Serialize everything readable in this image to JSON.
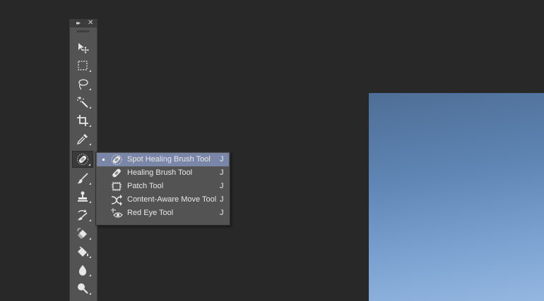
{
  "panel": {
    "collapse_glyph": "▸▸",
    "close_glyph": "✕",
    "tools": [
      {
        "name": "move-tool",
        "icon": "move-icon"
      },
      {
        "name": "rectangular-marquee-tool",
        "icon": "marquee-icon"
      },
      {
        "name": "lasso-tool",
        "icon": "lasso-icon"
      },
      {
        "name": "magic-wand-tool",
        "icon": "magic-wand-icon"
      },
      {
        "name": "crop-tool",
        "icon": "crop-icon"
      },
      {
        "name": "eyedropper-tool",
        "icon": "eyedropper-icon"
      },
      {
        "name": "spot-healing-brush-tool",
        "icon": "spot-healing-icon",
        "active": true
      },
      {
        "name": "brush-tool",
        "icon": "brush-icon"
      },
      {
        "name": "clone-stamp-tool",
        "icon": "stamp-icon"
      },
      {
        "name": "history-brush-tool",
        "icon": "history-brush-icon"
      },
      {
        "name": "eraser-tool",
        "icon": "eraser-icon"
      },
      {
        "name": "paint-bucket-tool",
        "icon": "paint-bucket-icon"
      },
      {
        "name": "blur-tool",
        "icon": "blur-drop-icon"
      },
      {
        "name": "dodge-tool",
        "icon": "dodge-icon"
      }
    ]
  },
  "flyout": {
    "items": [
      {
        "label": "Spot Healing Brush Tool",
        "shortcut": "J",
        "icon": "spot-healing-icon",
        "selected": true
      },
      {
        "label": "Healing Brush Tool",
        "shortcut": "J",
        "icon": "healing-brush-icon",
        "selected": false
      },
      {
        "label": "Patch Tool",
        "shortcut": "J",
        "icon": "patch-icon",
        "selected": false
      },
      {
        "label": "Content-Aware Move Tool",
        "shortcut": "J",
        "icon": "content-aware-move-icon",
        "selected": false
      },
      {
        "label": "Red Eye Tool",
        "shortcut": "J",
        "icon": "red-eye-icon",
        "selected": false
      }
    ]
  },
  "colors": {
    "background": "#282828",
    "panel": "#535353",
    "selected_row": "#7a86a8",
    "canvas_top": "#4e6e96",
    "canvas_bottom": "#94b7e0"
  }
}
